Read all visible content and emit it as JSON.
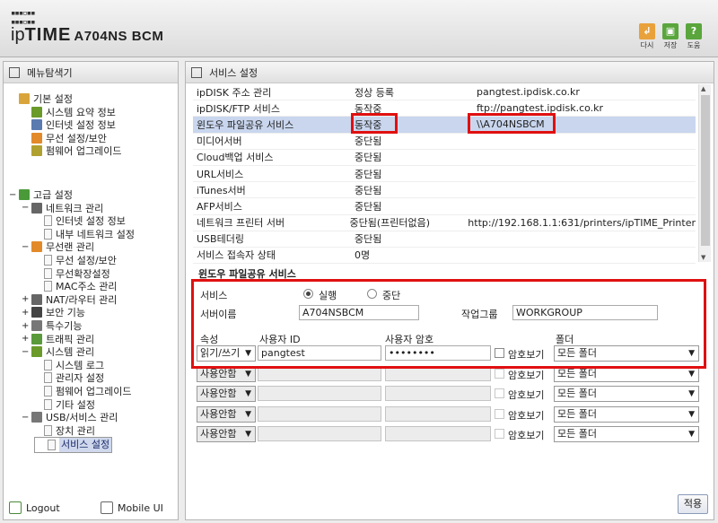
{
  "header": {
    "brand_prefix": "ip",
    "brand_main": "TIME",
    "model": "A704NS BCM",
    "buttons": [
      {
        "label": "다시",
        "color": "#e9a23b",
        "icon": "refresh-icon",
        "glyph": "↲"
      },
      {
        "label": "저장",
        "color": "#5aa63d",
        "icon": "save-icon",
        "glyph": "▣"
      },
      {
        "label": "도움",
        "color": "#5aa63d",
        "icon": "help-icon",
        "glyph": "?"
      }
    ]
  },
  "sidebar": {
    "title": "메뉴탐색기",
    "tree": [
      {
        "level": 0,
        "pm": "",
        "label": "기본 설정",
        "icon": "folder-gear-icon",
        "color": "#d9a53b"
      },
      {
        "level": 1,
        "pm": "",
        "label": "시스템 요약 정보",
        "icon": "chart-icon",
        "color": "#6a9a2a"
      },
      {
        "level": 1,
        "pm": "",
        "label": "인터넷 설정 정보",
        "icon": "network-icon",
        "color": "#5a7ab0"
      },
      {
        "level": 1,
        "pm": "",
        "label": "무선 설정/보안",
        "icon": "wireless-icon",
        "color": "#e28a2a"
      },
      {
        "level": 1,
        "pm": "",
        "label": "펌웨어 업그레이드",
        "icon": "firmware-icon",
        "color": "#b0a030"
      },
      {
        "level": 0,
        "pm": "−",
        "label": "고급 설정",
        "icon": "folder-gear-icon",
        "color": "#4a9a3a",
        "gap": true
      },
      {
        "level": 1,
        "pm": "−",
        "label": "네트워크 관리",
        "icon": "network-icon",
        "color": "#666"
      },
      {
        "level": 2,
        "pm": "",
        "label": "인터넷 설정 정보",
        "doc": true
      },
      {
        "level": 2,
        "pm": "",
        "label": "내부 네트워크 설정",
        "doc": true
      },
      {
        "level": 1,
        "pm": "−",
        "label": "무선랜 관리",
        "icon": "wireless-icon",
        "color": "#e28a2a"
      },
      {
        "level": 2,
        "pm": "",
        "label": "무선 설정/보안",
        "doc": true
      },
      {
        "level": 2,
        "pm": "",
        "label": "무선확장설정",
        "doc": true
      },
      {
        "level": 2,
        "pm": "",
        "label": "MAC주소 관리",
        "doc": true
      },
      {
        "level": 1,
        "pm": "+",
        "label": "NAT/라우터 관리",
        "icon": "router-icon",
        "color": "#666"
      },
      {
        "level": 1,
        "pm": "+",
        "label": "보안 기능",
        "icon": "lock-icon",
        "color": "#444"
      },
      {
        "level": 1,
        "pm": "+",
        "label": "특수기능",
        "icon": "special-icon",
        "color": "#777"
      },
      {
        "level": 1,
        "pm": "+",
        "label": "트래픽 관리",
        "icon": "traffic-icon",
        "color": "#5a9a3a"
      },
      {
        "level": 1,
        "pm": "−",
        "label": "시스템 관리",
        "icon": "chart-icon",
        "color": "#6a9a2a"
      },
      {
        "level": 2,
        "pm": "",
        "label": "시스템 로그",
        "doc": true
      },
      {
        "level": 2,
        "pm": "",
        "label": "관리자 설정",
        "doc": true
      },
      {
        "level": 2,
        "pm": "",
        "label": "펌웨어 업그레이드",
        "doc": true
      },
      {
        "level": 2,
        "pm": "",
        "label": "기타 설정",
        "doc": true
      },
      {
        "level": 1,
        "pm": "−",
        "label": "USB/서비스 관리",
        "icon": "usb-icon",
        "color": "#777"
      },
      {
        "level": 2,
        "pm": "",
        "label": "장치 관리",
        "doc": true
      },
      {
        "level": 2,
        "pm": "",
        "label": "서비스 설정",
        "doc": true,
        "selected": true
      }
    ],
    "footer": {
      "logout": "Logout",
      "mobile": "Mobile UI"
    }
  },
  "main": {
    "title": "서비스 설정",
    "services": [
      {
        "name": "ipDISK 주소 관리",
        "status": "정상 등록",
        "info": "pangtest.ipdisk.co.kr"
      },
      {
        "name": "ipDISK/FTP 서비스",
        "status": "동작중",
        "info": "ftp://pangtest.ipdisk.co.kr"
      },
      {
        "name": "윈도우 파일공유 서비스",
        "status": "동작중",
        "info": "\\\\A704NSBCM",
        "highlight": true
      },
      {
        "name": "미디어서버",
        "status": "중단됨",
        "info": ""
      },
      {
        "name": "Cloud백업 서비스",
        "status": "중단됨",
        "info": ""
      },
      {
        "name": "URL서비스",
        "status": "중단됨",
        "info": ""
      },
      {
        "name": "iTunes서버",
        "status": "중단됨",
        "info": ""
      },
      {
        "name": "AFP서비스",
        "status": "중단됨",
        "info": ""
      },
      {
        "name": "네트워크 프린터 서버",
        "status": "중단됨(프린터없음)",
        "info": "http://192.168.1.1:631/printers/ipTIME_Printer"
      },
      {
        "name": "USB테더링",
        "status": "중단됨",
        "info": ""
      },
      {
        "name": "서비스 접속자 상태",
        "status": "0명",
        "info": ""
      }
    ],
    "section_title": "윈도우 파일공유 서비스",
    "form": {
      "service_label": "서비스",
      "run_label": "실행",
      "stop_label": "중단",
      "server_name_label": "서버이름",
      "server_name_value": "A704NSBCM",
      "workgroup_label": "작업그룹",
      "workgroup_value": "WORKGROUP",
      "attr_header": "속성",
      "user_header": "사용자 ID",
      "pw_header": "사용자 암호",
      "folder_header": "폴더",
      "show_pw": "암호보기",
      "rows": [
        {
          "attr": "읽기/쓰기",
          "user": "pangtest",
          "pw": "••••••••",
          "folder": "모든 폴더",
          "active": true
        },
        {
          "attr": "사용안함",
          "user": "",
          "pw": "",
          "folder": "모든 폴더",
          "active": false
        },
        {
          "attr": "사용안함",
          "user": "",
          "pw": "",
          "folder": "모든 폴더",
          "active": false
        },
        {
          "attr": "사용안함",
          "user": "",
          "pw": "",
          "folder": "모든 폴더",
          "active": false
        },
        {
          "attr": "사용안함",
          "user": "",
          "pw": "",
          "folder": "모든 폴더",
          "active": false
        }
      ]
    },
    "apply_label": "적용"
  }
}
